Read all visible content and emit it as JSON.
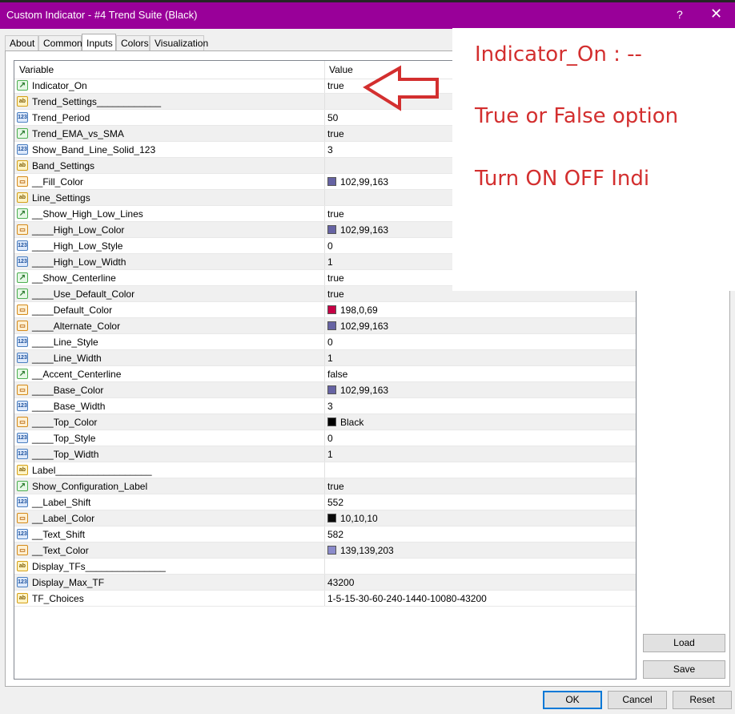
{
  "window": {
    "title": "Custom Indicator - #4 Trend Suite (Black)",
    "help": "?",
    "close": "✕"
  },
  "tabs": [
    {
      "label": "About"
    },
    {
      "label": "Common"
    },
    {
      "label": "Inputs"
    },
    {
      "label": "Colors"
    },
    {
      "label": "Visualization"
    }
  ],
  "grid": {
    "headers": {
      "variable": "Variable",
      "value": "Value"
    },
    "rows": [
      {
        "type": "bool",
        "name": "Indicator_On",
        "value": "true"
      },
      {
        "type": "string",
        "name": "Trend_Settings____________",
        "value": ""
      },
      {
        "type": "int",
        "name": "Trend_Period",
        "value": "50"
      },
      {
        "type": "bool",
        "name": "Trend_EMA_vs_SMA",
        "value": "true"
      },
      {
        "type": "int",
        "name": "Show_Band_Line_Solid_123",
        "value": "3"
      },
      {
        "type": "string",
        "name": "Band_Settings",
        "value": ""
      },
      {
        "type": "color",
        "name": "__Fill_Color",
        "value": "102,99,163",
        "swatch": "#6663a3"
      },
      {
        "type": "string",
        "name": "Line_Settings",
        "value": ""
      },
      {
        "type": "bool",
        "name": "__Show_High_Low_Lines",
        "value": "true"
      },
      {
        "type": "color",
        "name": "____High_Low_Color",
        "value": "102,99,163",
        "swatch": "#6663a3"
      },
      {
        "type": "int",
        "name": "____High_Low_Style",
        "value": "0"
      },
      {
        "type": "int",
        "name": "____High_Low_Width",
        "value": "1"
      },
      {
        "type": "bool",
        "name": "__Show_Centerline",
        "value": "true"
      },
      {
        "type": "bool",
        "name": "____Use_Default_Color",
        "value": "true"
      },
      {
        "type": "color",
        "name": "____Default_Color",
        "value": "198,0,69",
        "swatch": "#c60045"
      },
      {
        "type": "color",
        "name": "____Alternate_Color",
        "value": "102,99,163",
        "swatch": "#6663a3"
      },
      {
        "type": "int",
        "name": "____Line_Style",
        "value": "0"
      },
      {
        "type": "int",
        "name": "____Line_Width",
        "value": "1"
      },
      {
        "type": "bool",
        "name": "__Accent_Centerline",
        "value": "false"
      },
      {
        "type": "color",
        "name": "____Base_Color",
        "value": "102,99,163",
        "swatch": "#6663a3"
      },
      {
        "type": "int",
        "name": "____Base_Width",
        "value": "3"
      },
      {
        "type": "color",
        "name": "____Top_Color",
        "value": "Black",
        "swatch": "#000000"
      },
      {
        "type": "int",
        "name": "____Top_Style",
        "value": "0"
      },
      {
        "type": "int",
        "name": "____Top_Width",
        "value": "1"
      },
      {
        "type": "string",
        "name": "Label__________________",
        "value": ""
      },
      {
        "type": "bool",
        "name": "Show_Configuration_Label",
        "value": "true"
      },
      {
        "type": "int",
        "name": "__Label_Shift",
        "value": "552"
      },
      {
        "type": "color",
        "name": "__Label_Color",
        "value": "10,10,10",
        "swatch": "#0a0a0a"
      },
      {
        "type": "int",
        "name": "__Text_Shift",
        "value": "582"
      },
      {
        "type": "color",
        "name": "__Text_Color",
        "value": "139,139,203",
        "swatch": "#8b8bcb"
      },
      {
        "type": "string",
        "name": "Display_TFs_______________",
        "value": ""
      },
      {
        "type": "int",
        "name": "Display_Max_TF",
        "value": "43200"
      },
      {
        "type": "string",
        "name": "TF_Choices",
        "value": "1-5-15-30-60-240-1440-10080-43200"
      }
    ]
  },
  "annotation": {
    "line1": "Indicator_On : --",
    "line2": "True or False option",
    "line3": "Turn ON OFF Indi",
    "color": "#d32f2f"
  },
  "buttons": {
    "load": "Load",
    "save": "Save",
    "ok": "OK",
    "cancel": "Cancel",
    "reset": "Reset"
  },
  "icons": {
    "bool": "bool-icon",
    "string": "ab-icon",
    "int": "123-icon",
    "color": "color-icon"
  },
  "colors": {
    "titlebar": "#990099",
    "arrow": "#d32f2f"
  }
}
